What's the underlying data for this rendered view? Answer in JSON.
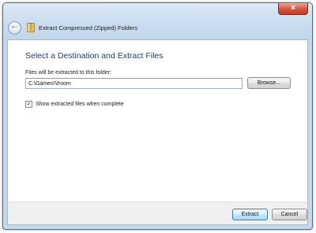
{
  "window": {
    "title": "Extract Compressed (Zipped) Folders",
    "close_glyph": "x",
    "back_glyph": "←"
  },
  "icons": {
    "back": "back-arrow-icon",
    "zip": "zipped-folder-icon",
    "close": "close-icon",
    "check": "checkmark-icon"
  },
  "main": {
    "heading": "Select a Destination and Extract Files",
    "field_label": "Files will be extracted to this folder:",
    "path_value": "C:\\Games\\Vroom",
    "browse_label": "Browse...",
    "checkbox_checked": true,
    "checkbox_glyph": "✓",
    "checkbox_label": "Show extracted files when complete"
  },
  "footer": {
    "extract_label": "Extract",
    "cancel_label": "Cancel"
  },
  "colors": {
    "heading": "#1e3a8a",
    "close_button": "#c23b27",
    "frame": "#c5d9ee"
  }
}
